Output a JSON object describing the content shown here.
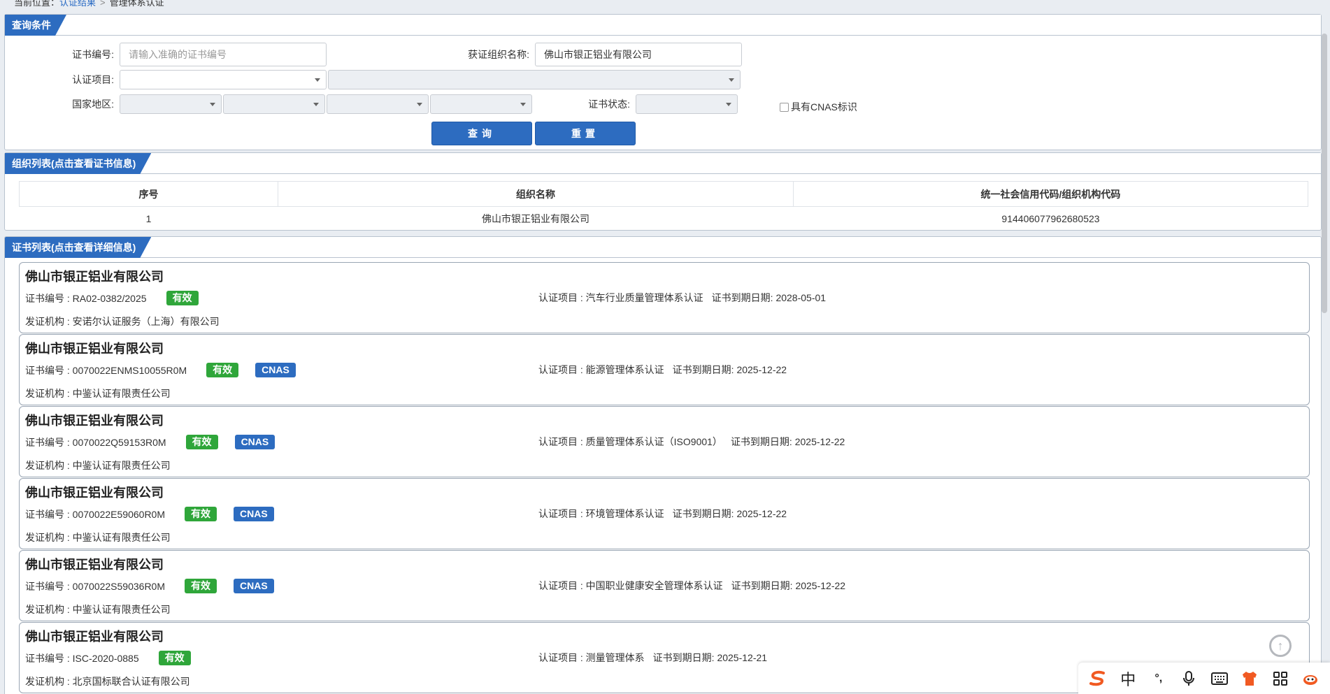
{
  "breadcrumb": {
    "label": "当前位置：",
    "home": "认证结果",
    "current": "管理体系认证"
  },
  "query": {
    "tab": "查询条件",
    "cert_no_label": "证书编号:",
    "cert_no_placeholder": "请输入准确的证书编号",
    "org_name_label": "获证组织名称:",
    "org_name_value": "佛山市银正铝业有限公司",
    "project_label": "认证项目:",
    "region_label": "国家地区:",
    "status_label": "证书状态:",
    "cnas_label": "具有CNAS标识",
    "search_btn": "查询",
    "reset_btn": "重置"
  },
  "org_list": {
    "tab": "组织列表(点击查看证书信息)",
    "headers": [
      "序号",
      "组织名称",
      "统一社会信用代码/组织机构代码"
    ],
    "rows": [
      [
        "1",
        "佛山市银正铝业有限公司",
        "914406077962680523"
      ]
    ]
  },
  "cert_list": {
    "tab": "证书列表(点击查看详细信息)",
    "items": [
      {
        "title": "佛山市银正铝业有限公司",
        "cert_no": "证书编号 : RA02-0382/2025",
        "status": "有效",
        "cnas": "",
        "project": "认证项目 : 汽车行业质量管理体系认证",
        "expiry": "证书到期日期: 2028-05-01",
        "issuer": "发证机构 : 安诺尔认证服务（上海）有限公司"
      },
      {
        "title": "佛山市银正铝业有限公司",
        "cert_no": "证书编号 : 0070022ENMS10055R0M",
        "status": "有效",
        "cnas": "CNAS",
        "project": "认证项目 : 能源管理体系认证",
        "expiry": "证书到期日期: 2025-12-22",
        "issuer": "发证机构 : 中鉴认证有限责任公司"
      },
      {
        "title": "佛山市银正铝业有限公司",
        "cert_no": "证书编号 : 0070022Q59153R0M",
        "status": "有效",
        "cnas": "CNAS",
        "project": "认证项目 : 质量管理体系认证（ISO9001）",
        "expiry": "证书到期日期: 2025-12-22",
        "issuer": "发证机构 : 中鉴认证有限责任公司"
      },
      {
        "title": "佛山市银正铝业有限公司",
        "cert_no": "证书编号 : 0070022E59060R0M",
        "status": "有效",
        "cnas": "CNAS",
        "project": "认证项目 : 环境管理体系认证",
        "expiry": "证书到期日期: 2025-12-22",
        "issuer": "发证机构 : 中鉴认证有限责任公司"
      },
      {
        "title": "佛山市银正铝业有限公司",
        "cert_no": "证书编号 : 0070022S59036R0M",
        "status": "有效",
        "cnas": "CNAS",
        "project": "认证项目 : 中国职业健康安全管理体系认证",
        "expiry": "证书到期日期: 2025-12-22",
        "issuer": "发证机构 : 中鉴认证有限责任公司"
      },
      {
        "title": "佛山市银正铝业有限公司",
        "cert_no": "证书编号 : ISC-2020-0885",
        "status": "有效",
        "cnas": "",
        "project": "认证项目 : 测量管理体系",
        "expiry": "证书到期日期: 2025-12-21",
        "issuer": "发证机构 : 北京国标联合认证有限公司"
      }
    ]
  },
  "ime": {
    "mode": "中",
    "punct": "°,"
  },
  "colors": {
    "accent": "#2d6cc0",
    "valid": "#2fa63a",
    "sogou": "#f15a22"
  }
}
